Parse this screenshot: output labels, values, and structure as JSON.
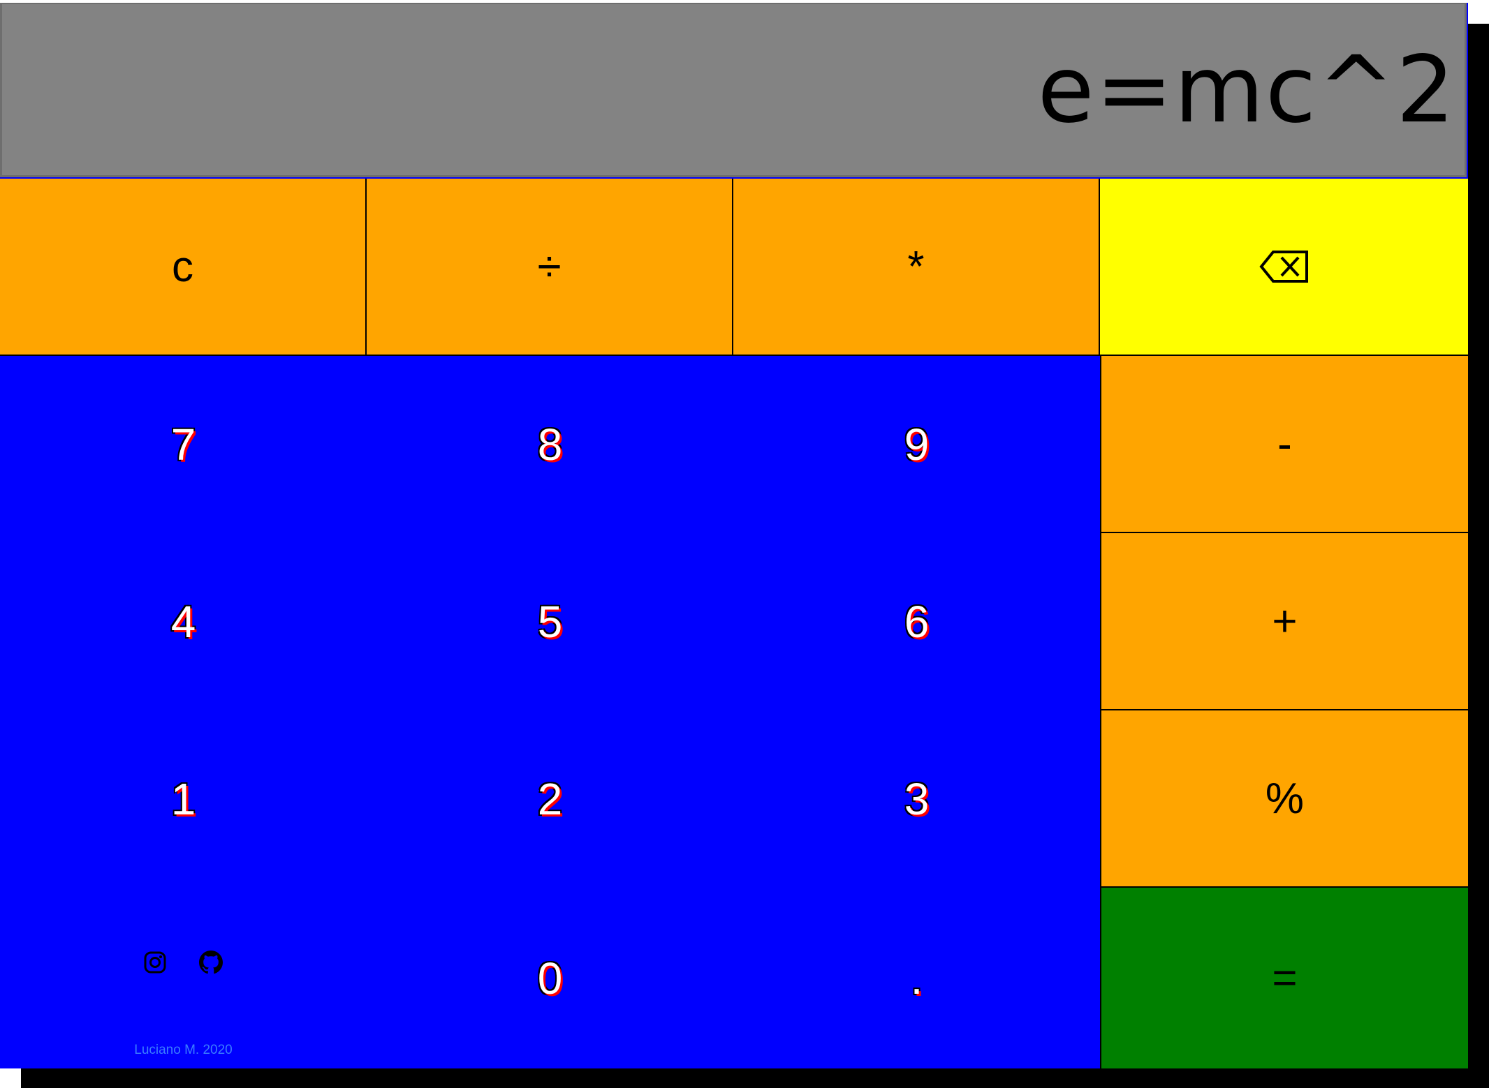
{
  "display": {
    "value": "e=mc^2"
  },
  "keys": {
    "clear": "c",
    "divide": "÷",
    "multiply": "*",
    "backspace_icon": "backspace-icon",
    "seven": "7",
    "eight": "8",
    "nine": "9",
    "minus": "-",
    "four": "4",
    "five": "5",
    "six": "6",
    "plus": "+",
    "one": "1",
    "two": "2",
    "three": "3",
    "percent": "%",
    "zero": "0",
    "decimal": ".",
    "equals": "="
  },
  "footer": {
    "icons": [
      "instagram-icon",
      "github-icon"
    ],
    "credit": "Luciano M. 2020"
  },
  "colors": {
    "display_bg": "#838383",
    "operator_bg": "#ffa500",
    "backspace_bg": "#ffff00",
    "number_bg": "#0000ff",
    "equals_bg": "#008000",
    "shadow": "#000000"
  }
}
